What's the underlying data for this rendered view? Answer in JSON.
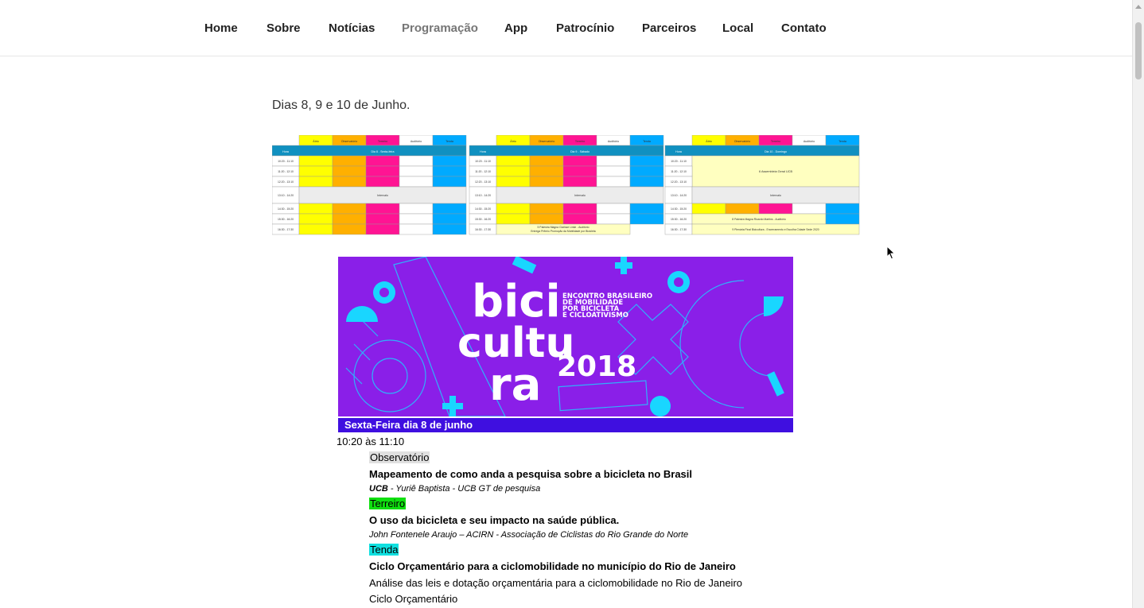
{
  "nav": {
    "items": [
      {
        "label": "Home"
      },
      {
        "label": "Sobre"
      },
      {
        "label": "Notícias"
      },
      {
        "label": "Programação",
        "active": true
      },
      {
        "label": "App"
      },
      {
        "label": "Patrocínio"
      },
      {
        "label": "Parceiros"
      },
      {
        "label": "Local"
      },
      {
        "label": "Contato"
      }
    ]
  },
  "intro": "Dias 8, 9 e 10 de Junho.",
  "schedule_image": {
    "rooms": [
      "Átrio",
      "Observatório",
      "Terreiro",
      "Auditório",
      "Tenda"
    ],
    "day1_header": "Dia 8 - Sexta-feira",
    "day2_header": "Dia 9 - Sábado",
    "day3_header": "Dia 10 - Domingo",
    "hour_label": "Hora",
    "times": [
      "10:20 - 11:10",
      "11:20 - 12:10",
      "12:20 - 13:10",
      "13:10 - 14:20",
      "14:30 - 15:20",
      "15:30 - 16:20",
      "16:30 - 17:30"
    ],
    "interval": "Intervalo",
    "assembly": "6 Assembleia Geral UCB",
    "palestra_d2": "5 Palestra Magna Clarisse Linke - Auditório",
    "premio_d2": "Entrega Prêmio Promoção da Mobilidade por Bicicleta",
    "palestra_d3": "8 Palestra Magna Ricardo Martins - Auditório",
    "plenaria_d3": "9 Plenária Final Bicicultura - Encerramento e Escolha Cidade Sede 2020"
  },
  "banner": {
    "logo_lines": [
      "bici",
      "cultu",
      "ra"
    ],
    "year": "2018",
    "tagline": [
      "ENCONTRO BRASILEIRO",
      "DE MOBILIDADE",
      "POR BICICLETA",
      "E CICLOATIVISMO"
    ]
  },
  "day_band": "Sexta-Feira dia 8 de junho",
  "program": {
    "time": "10:20 às 11:10",
    "sessions": [
      {
        "room": "Observatório",
        "room_color": "#e0e0e0",
        "title": "Mapeamento de como anda a pesquisa sobre a bicicleta no Brasil",
        "org": "UCB",
        "speaker": " - Yuriê Baptista - UCB GT de pesquisa"
      },
      {
        "room": "Terreiro",
        "room_color": "#10e010",
        "title": "O uso da bicicleta e seu impacto na saúde pública.",
        "speaker": "John Fontenele Araujo – ACIRN - Associação de Ciclistas do Rio Grande do Norte"
      },
      {
        "room": "Tenda",
        "room_color": "#10e0e0",
        "title": "Ciclo Orçamentário para a ciclomobilidade no município do Rio de Janeiro",
        "desc1": "Análise das leis e dotação orçamentária para a ciclomobilidade no Rio de Janeiro",
        "desc2": "Ciclo Orçamentário"
      }
    ]
  },
  "colors": {
    "atrio": "#ffff00",
    "observatorio": "#ffb000",
    "terreiro": "#ff1493",
    "auditorio": "#ffffff",
    "tenda": "#00aaff",
    "header": "#1090c0",
    "banner": "#8a1fe8",
    "cyan": "#00e5ff"
  }
}
